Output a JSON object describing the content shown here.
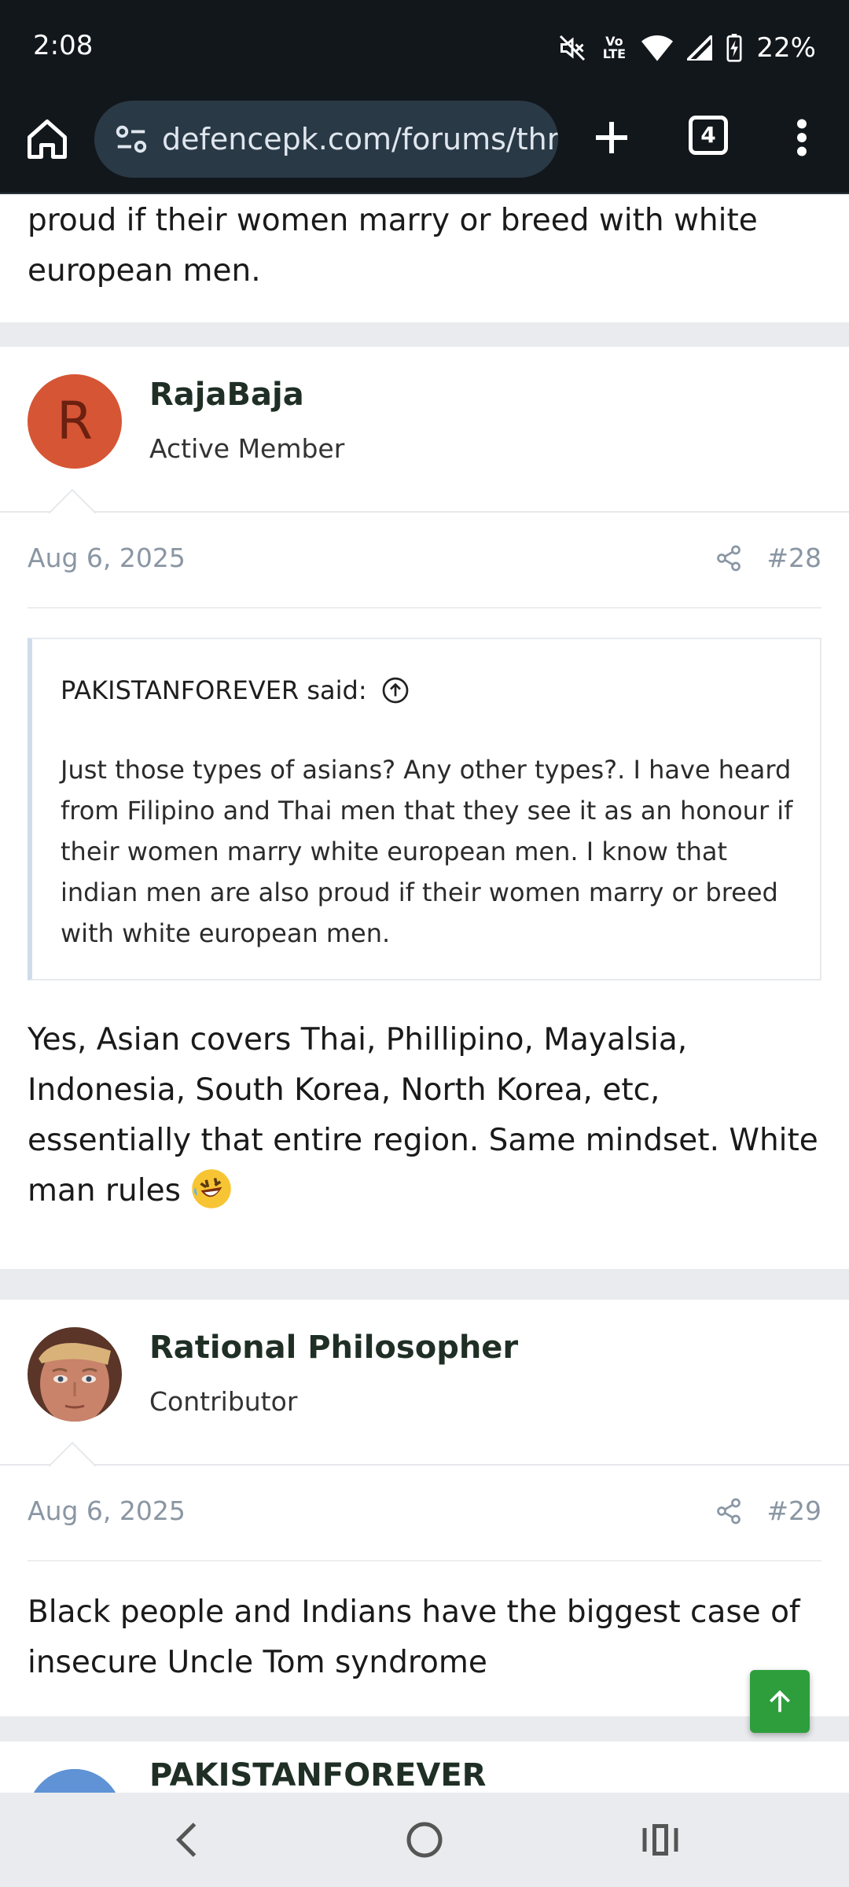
{
  "status": {
    "time": "2:08",
    "network": "Vo LTE",
    "battery": "22%"
  },
  "browser": {
    "url": "defencepk.com/forums/thre",
    "tab_count": "4"
  },
  "previous_post": {
    "text_end": "proud if their women marry or breed with white european men."
  },
  "posts": [
    {
      "avatar_letter": "R",
      "username": "RajaBaja",
      "user_title": "Active Member",
      "date": "Aug 6, 2025",
      "number": "#28",
      "quote": {
        "author": "PAKISTANFOREVER said:",
        "text": "Just those types of asians? Any other types?. I have heard from Filipino and Thai men that they see it as an honour if their women marry white european men. I know that indian men are also proud if their women marry or breed with white european men."
      },
      "body": "Yes, Asian covers Thai, Phillipino, Mayalsia, Indonesia, South Korea, North Korea, etc, essentially that entire region. Same mindset. White man rules"
    },
    {
      "username": "Rational Philosopher",
      "user_title": "Contributor",
      "date": "Aug 6, 2025",
      "number": "#29",
      "body": "Black people and Indians have the biggest case of insecure Uncle Tom syndrome"
    },
    {
      "username": "PAKISTANFOREVER"
    }
  ],
  "colors": {
    "accent_green": "#2e9e3d",
    "avatar_orange": "#d65534",
    "meta_gray": "#8a96a3"
  }
}
